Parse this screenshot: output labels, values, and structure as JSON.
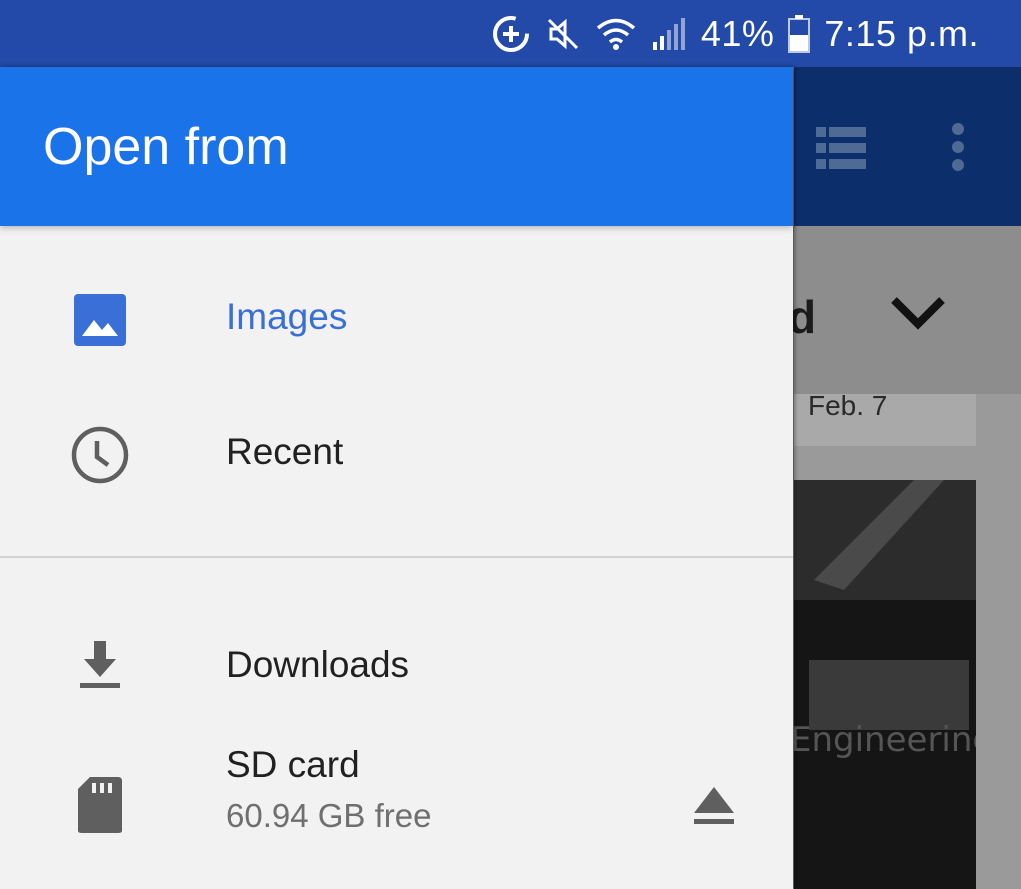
{
  "status_bar": {
    "battery_percent": "41%",
    "time": "7:15 p.m.",
    "icons": [
      "add-circle-icon",
      "mute-icon",
      "wifi-icon",
      "signal-icon",
      "battery-icon"
    ]
  },
  "background_app": {
    "toolbar_icons": [
      "list-view-icon",
      "more-vert-icon"
    ],
    "title_fragment": "d",
    "date_label": "Feb. 7",
    "photo_caption": "Engineering"
  },
  "drawer": {
    "title": "Open from",
    "items": [
      {
        "label": "Images",
        "icon": "image-icon",
        "active": true
      },
      {
        "label": "Recent",
        "icon": "clock-icon",
        "active": false
      }
    ],
    "storage": [
      {
        "label": "Downloads",
        "icon": "download-icon"
      },
      {
        "label": "SD card",
        "subtitle": "60.94 GB free",
        "icon": "sd-card-icon",
        "action_icon": "eject-icon"
      }
    ]
  },
  "colors": {
    "status_bar": "#234aa8",
    "drawer_header": "#1a73e8",
    "active_label": "#3a6fd8",
    "drawer_background": "#f2f2f2"
  }
}
